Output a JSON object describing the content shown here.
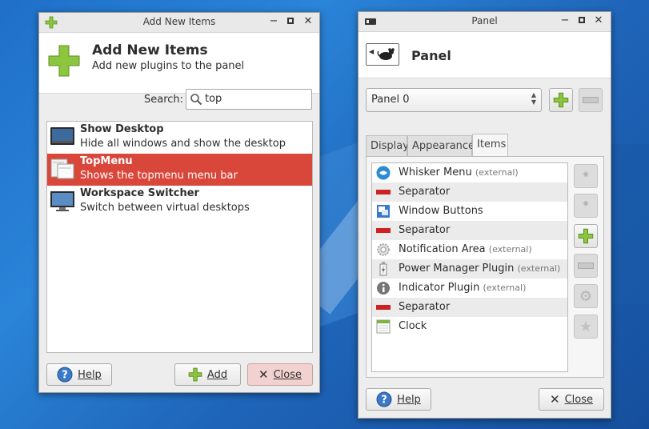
{
  "add_window": {
    "title": "Add New Items",
    "header_title": "Add New Items",
    "header_subtitle": "Add new plugins to the panel",
    "search_label": "Search:",
    "search_value": "top",
    "plugins": [
      {
        "name": "Show Desktop",
        "desc": "Hide all windows and show the desktop",
        "icon": "show-desktop-icon"
      },
      {
        "name": "TopMenu",
        "desc": "Shows the topmenu menu bar",
        "icon": "topmenu-icon"
      },
      {
        "name": "Workspace Switcher",
        "desc": "Switch between virtual desktops",
        "icon": "workspace-switcher-icon"
      }
    ],
    "help_label": "Help",
    "add_label": "Add",
    "close_label": "Close"
  },
  "panel_window": {
    "title": "Panel",
    "header_title": "Panel",
    "panel_select": "Panel 0",
    "tabs": [
      "Display",
      "Appearance",
      "Items"
    ],
    "active_tab": "Items",
    "items": [
      {
        "name": "Whisker Menu",
        "ext": "(external)",
        "icon": "whisker-menu-icon"
      },
      {
        "name": "Separator",
        "ext": "",
        "icon": "separator-icon"
      },
      {
        "name": "Window Buttons",
        "ext": "",
        "icon": "window-buttons-icon"
      },
      {
        "name": "Separator",
        "ext": "",
        "icon": "separator-icon"
      },
      {
        "name": "Notification Area",
        "ext": "(external)",
        "icon": "notification-area-icon"
      },
      {
        "name": "Power Manager Plugin",
        "ext": "(external)",
        "icon": "power-manager-icon"
      },
      {
        "name": "Indicator Plugin",
        "ext": "(external)",
        "icon": "indicator-icon"
      },
      {
        "name": "Separator",
        "ext": "",
        "icon": "separator-icon"
      },
      {
        "name": "Clock",
        "ext": "",
        "icon": "clock-icon"
      }
    ],
    "help_label": "Help",
    "close_label": "Close"
  },
  "colors": {
    "selection": "#d9473b",
    "plus_green": "#8cc63f",
    "separator_red": "#cc2222"
  }
}
